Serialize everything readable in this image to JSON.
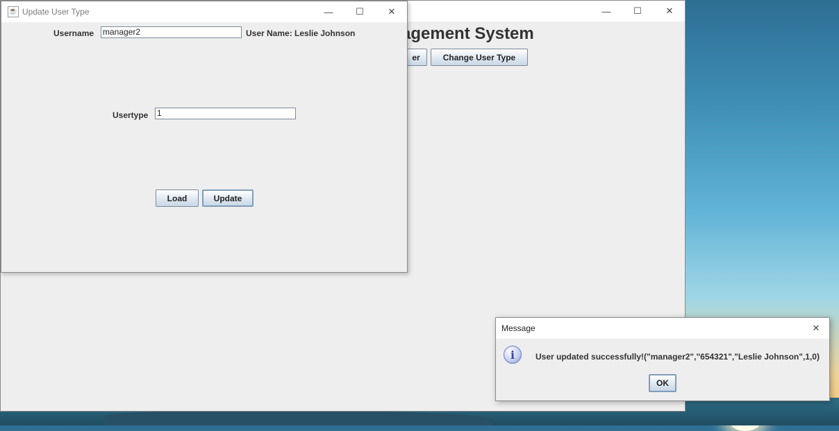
{
  "desktop": {},
  "main_window": {
    "title_partial": "agement System",
    "button_partial": "er",
    "change_user_type_label": "Change User Type",
    "minimize": "—",
    "maximize": "☐",
    "close": "✕"
  },
  "update_window": {
    "title": "Update User Type",
    "username_label": "Username",
    "username_value": "manager2",
    "user_name_display": "User Name: Leslie Johnson",
    "usertype_label": "Usertype",
    "usertype_value": "1",
    "load_label": "Load",
    "update_label": "Update",
    "minimize": "—",
    "maximize": "☐",
    "close": "✕"
  },
  "message_dialog": {
    "title": "Message",
    "text": "User updated successfully!(\"manager2\",\"654321\",\"Leslie Johnson\",1,0)",
    "ok_label": "OK",
    "close": "✕",
    "info_glyph": "i"
  }
}
